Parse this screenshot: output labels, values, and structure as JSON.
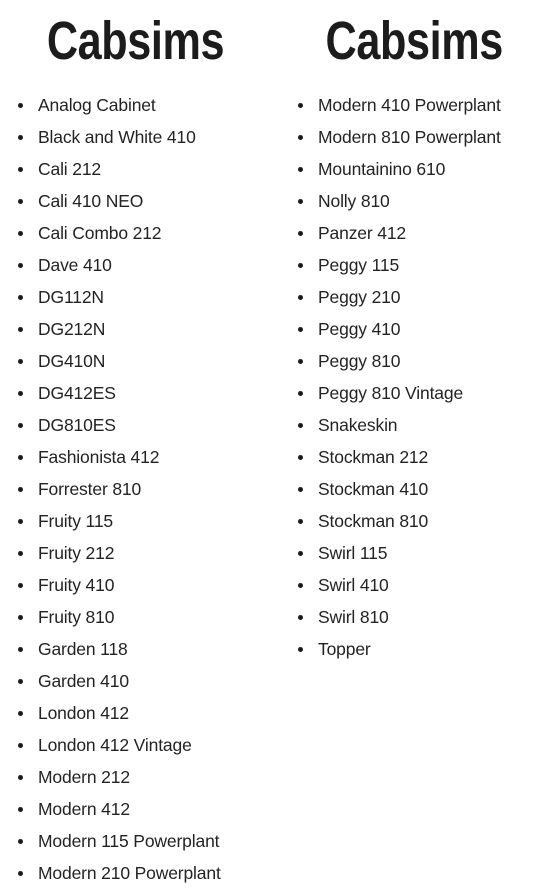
{
  "document": {
    "background_color": "#ffffff",
    "text_color": "#232323",
    "heading_color": "#1c1c1c",
    "bullet_glyph": "•"
  },
  "columns": [
    {
      "heading": "Cabsims",
      "items": [
        "Analog Cabinet",
        "Black and White 410",
        "Cali 212",
        "Cali 410 NEO",
        "Cali Combo 212",
        "Dave 410",
        "DG112N",
        "DG212N",
        "DG410N",
        "DG412ES",
        "DG810ES",
        "Fashionista 412",
        "Forrester 810",
        "Fruity 115",
        "Fruity 212",
        "Fruity 410",
        "Fruity 810",
        "Garden 118",
        "Garden 410",
        "London 412",
        "London 412 Vintage",
        "Modern 212",
        "Modern 412",
        "Modern 115 Powerplant",
        "Modern 210 Powerplant"
      ]
    },
    {
      "heading": "Cabsims",
      "items": [
        "Modern 410 Powerplant",
        "Modern 810 Powerplant",
        "Mountainino 610",
        "Nolly 810",
        "Panzer 412",
        "Peggy 115",
        "Peggy 210",
        "Peggy 410",
        "Peggy 810",
        "Peggy 810 Vintage",
        "Snakeskin",
        "Stockman 212",
        "Stockman 410",
        "Stockman 810",
        "Swirl 115",
        "Swirl 410",
        "Swirl 810",
        "Topper"
      ]
    }
  ]
}
